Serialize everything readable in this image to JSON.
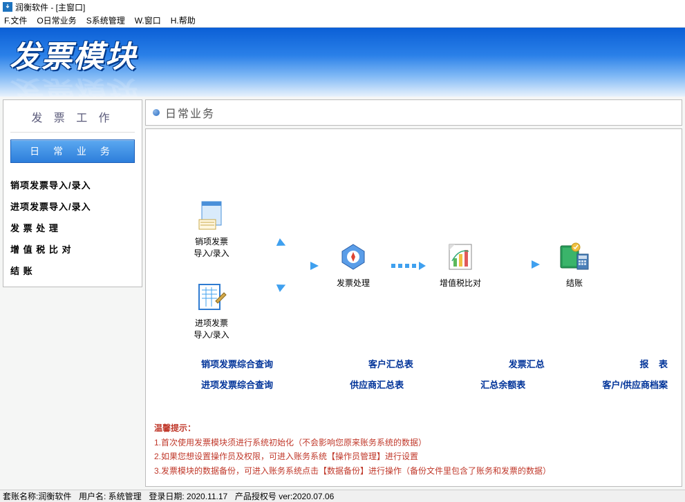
{
  "window": {
    "title": "润衡软件 - [主窗口]"
  },
  "menu": {
    "file": "F.文件",
    "daily": "O日常业务",
    "system": "S系统管理",
    "window": "W.窗口",
    "help": "H.帮助"
  },
  "banner": {
    "title": "发票模块"
  },
  "sidebar": {
    "heading": "发 票 工 作",
    "active": "日 常 业 务",
    "items": [
      "销项发票导入/录入",
      "进项发票导入/录入",
      "发 票 处 理",
      "增 值 税 比 对",
      "结          账"
    ]
  },
  "content": {
    "title": "日常业务",
    "flow": {
      "sales_import": "销项发票\n导入/录入",
      "purchase_import": "进项发票\n导入/录入",
      "invoice_process": "发票处理",
      "vat_compare": "增值税比对",
      "close": "结账"
    },
    "links_row1": [
      "销项发票综合查询",
      "客户汇总表",
      "发票汇总",
      "报    表"
    ],
    "links_row2": [
      "进项发票综合查询",
      "供应商汇总表",
      "汇总余额表",
      "客户/供应商档案"
    ],
    "tips": {
      "header": "温馨提示：",
      "l1": "1.首次使用发票模块须进行系统初始化（不会影响您原来账务系统的数据）",
      "l2": "2.如果您想设置操作员及权限，可进入账务系统【操作员管理】进行设置",
      "l3": "3.发票模块的数据备份，可进入账务系统点击【数据备份】进行操作（备份文件里包含了账务和发票的数据）"
    }
  },
  "status": {
    "account": "套账名称:润衡软件",
    "user": "用户名: 系统管理",
    "login": "登录日期: 2020.11.17",
    "license": "产品授权号  ver:2020.07.06"
  }
}
